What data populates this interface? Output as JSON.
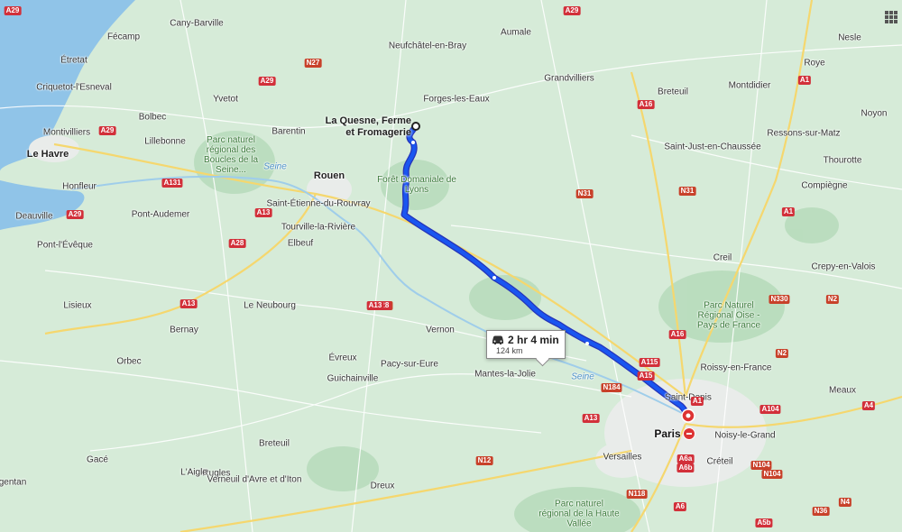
{
  "map": {
    "origin_label": [
      "La Quesne, Ferme",
      "et Fromagerie"
    ],
    "route": {
      "duration": "2 hr 4 min",
      "distance": "124 km"
    },
    "destination": "Paris",
    "colors": {
      "land": "#d6ebd8",
      "sea": "#90c4e8",
      "route": "#1a56f0",
      "route_outline": "#2533b8",
      "forest": "#b8dcbc",
      "urban": "#e9ecea"
    },
    "places": [
      {
        "name": "Cany-Barville",
        "kind": "small"
      },
      {
        "name": "Fécamp",
        "kind": "small"
      },
      {
        "name": "Étretat",
        "kind": "small"
      },
      {
        "name": "Criquetot-l'Esneval",
        "kind": "small"
      },
      {
        "name": "Yvetot",
        "kind": "small"
      },
      {
        "name": "Bolbec",
        "kind": "small"
      },
      {
        "name": "Montivilliers",
        "kind": "small"
      },
      {
        "name": "Lillebonne",
        "kind": "small"
      },
      {
        "name": "Le Havre",
        "kind": "city"
      },
      {
        "name": "Barentin",
        "kind": "small"
      },
      {
        "name": "Rouen",
        "kind": "city"
      },
      {
        "name": "Honfleur",
        "kind": "small"
      },
      {
        "name": "Deauville",
        "kind": "small"
      },
      {
        "name": "Pont-Audemer",
        "kind": "small"
      },
      {
        "name": "Saint-Étienne-du-Rouvray",
        "kind": "small"
      },
      {
        "name": "Tourville-la-Rivière",
        "kind": "small"
      },
      {
        "name": "Elbeuf",
        "kind": "small"
      },
      {
        "name": "Pont-l'Évêque",
        "kind": "small"
      },
      {
        "name": "Lisieux",
        "kind": "small"
      },
      {
        "name": "Le Neubourg",
        "kind": "small"
      },
      {
        "name": "Bernay",
        "kind": "small"
      },
      {
        "name": "Orbec",
        "kind": "small"
      },
      {
        "name": "Évreux",
        "kind": "small"
      },
      {
        "name": "Guichainville",
        "kind": "small"
      },
      {
        "name": "Pacy-sur-Eure",
        "kind": "small"
      },
      {
        "name": "Vernon",
        "kind": "small"
      },
      {
        "name": "Mantes-la-Jolie",
        "kind": "small"
      },
      {
        "name": "Neufchâtel-en-Bray",
        "kind": "small"
      },
      {
        "name": "Aumale",
        "kind": "small"
      },
      {
        "name": "Forges-les-Eaux",
        "kind": "small"
      },
      {
        "name": "Grandvilliers",
        "kind": "small"
      },
      {
        "name": "Breteuil",
        "kind": "small"
      },
      {
        "name": "Montdidier",
        "kind": "small"
      },
      {
        "name": "Roye",
        "kind": "small"
      },
      {
        "name": "Nesle",
        "kind": "small"
      },
      {
        "name": "Noyon",
        "kind": "small"
      },
      {
        "name": "Saint-Just-en-Chaussée",
        "kind": "small"
      },
      {
        "name": "Ressons-sur-Matz",
        "kind": "small"
      },
      {
        "name": "Thourotte",
        "kind": "small"
      },
      {
        "name": "Compiègne",
        "kind": "small"
      },
      {
        "name": "Creil",
        "kind": "small"
      },
      {
        "name": "Crepy-en-Valois",
        "kind": "small"
      },
      {
        "name": "Roissy-en-France",
        "kind": "small"
      },
      {
        "name": "Saint-Denis",
        "kind": "small"
      },
      {
        "name": "Meaux",
        "kind": "small"
      },
      {
        "name": "Noisy-le-Grand",
        "kind": "small"
      },
      {
        "name": "Créteil",
        "kind": "small"
      },
      {
        "name": "Versailles",
        "kind": "small"
      },
      {
        "name": "Breteuil",
        "kind": "small"
      },
      {
        "name": "Rugles",
        "kind": "small"
      },
      {
        "name": "Gacé",
        "kind": "small"
      },
      {
        "name": "L'Aigle",
        "kind": "small"
      },
      {
        "name": "Verneuil d'Avre et d'Iton",
        "kind": "small"
      },
      {
        "name": "Dreux",
        "kind": "small"
      },
      {
        "name": "gentan",
        "kind": "small"
      }
    ],
    "parks": [
      "Parc naturel régional des Boucles de la Seine...",
      "Forêt Domaniale de Lyons",
      "Parc Naturel Régional Oise - Pays de France",
      "Parc naturel régional de la Haute Vallée"
    ],
    "rivers": [
      "Seine",
      "Seine"
    ],
    "road_shields": [
      "A29",
      "N27",
      "A29",
      "A29",
      "A131",
      "A29",
      "A13",
      "A28",
      "A13",
      "N154",
      "A28",
      "A13",
      "A16",
      "N31",
      "N31",
      "A16",
      "A1",
      "A1",
      "N330",
      "N2",
      "N2",
      "A115",
      "A15",
      "N184",
      "A13",
      "A1",
      "A104",
      "A4",
      "A6a",
      "A6b",
      "N12",
      "N118",
      "A6",
      "A5b",
      "N104",
      "N36",
      "N4",
      "N104",
      "A29"
    ],
    "icons": {
      "apps": "apps-grid-icon",
      "car": "car-icon",
      "origin": "origin-circle-icon",
      "destination": "destination-pin-icon"
    }
  }
}
